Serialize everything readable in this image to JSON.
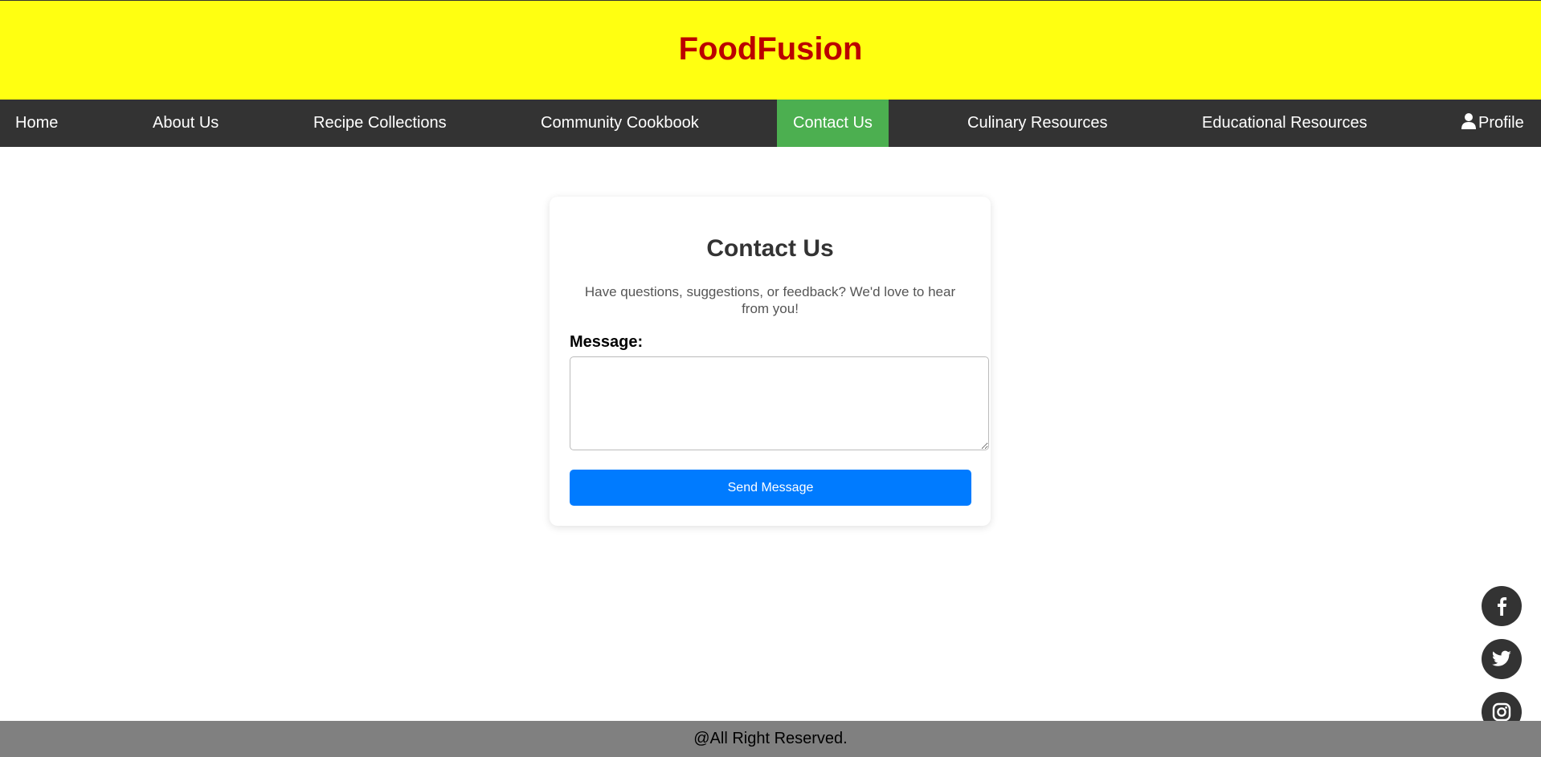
{
  "header": {
    "brand": "FoodFusion"
  },
  "nav": {
    "items": [
      {
        "label": "Home"
      },
      {
        "label": "About Us"
      },
      {
        "label": "Recipe Collections"
      },
      {
        "label": "Community Cookbook"
      },
      {
        "label": "Contact Us",
        "active": true
      },
      {
        "label": "Culinary Resources"
      },
      {
        "label": "Educational Resources"
      },
      {
        "label": "Profile",
        "icon": "user-icon"
      }
    ]
  },
  "contact": {
    "title": "Contact Us",
    "description": "Have questions, suggestions, or feedback? We'd love to hear from you!",
    "message_label": "Message:",
    "message_value": "",
    "send_label": "Send Message"
  },
  "social": [
    {
      "icon": "facebook-icon"
    },
    {
      "icon": "twitter-icon"
    },
    {
      "icon": "instagram-icon"
    }
  ],
  "footer": {
    "text": "@All Right Reserved."
  },
  "colors": {
    "header_bg": "#ffff11",
    "brand": "#bb0000",
    "nav_bg": "#333333",
    "nav_active": "#4caf50",
    "button": "#007bff",
    "footer_bg": "#808080"
  }
}
